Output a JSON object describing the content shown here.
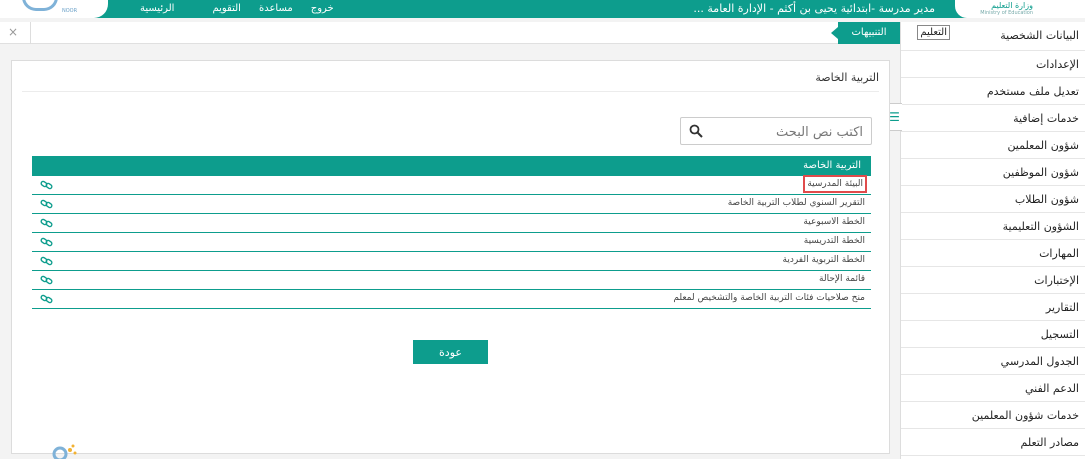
{
  "header": {
    "ministry_ar": "وزارة التعليم",
    "ministry_en": "Ministry of Education",
    "logo_sub": "NOOR",
    "title": "مدير مدرسة -ابتدائية يحيى بن أكثم - الإدارة العامة ...",
    "nav": [
      {
        "label": "الرئيسية"
      },
      {
        "label": "التقويم"
      },
      {
        "label": "مساعدة"
      },
      {
        "label": "خروج"
      }
    ]
  },
  "notifications": {
    "tab_label": "التنبيهات",
    "close_label": "×"
  },
  "sidebar": {
    "tooltip": "التعليم",
    "items": [
      {
        "label": "البيانات الشخصية"
      },
      {
        "label": "الإعدادات"
      },
      {
        "label": "تعديل ملف مستخدم"
      },
      {
        "label": "خدمات إضافية"
      },
      {
        "label": "شؤون المعلمين"
      },
      {
        "label": "شؤون الموظفين"
      },
      {
        "label": "شؤون الطلاب"
      },
      {
        "label": "الشؤون التعليمية"
      },
      {
        "label": "المهارات"
      },
      {
        "label": "الإختبارات"
      },
      {
        "label": "التقارير"
      },
      {
        "label": "التسجيل"
      },
      {
        "label": "الجدول المدرسي"
      },
      {
        "label": "الدعم الفني"
      },
      {
        "label": "خدمات شؤون المعلمين"
      },
      {
        "label": "مصادر التعلم"
      }
    ],
    "toggle_label": "☰"
  },
  "main": {
    "title": "التربية الخاصة",
    "search": {
      "placeholder": "اكتب نص البحث",
      "value": ""
    },
    "table": {
      "header": "التربية الخاصة",
      "rows": [
        {
          "label": "البيئة المدرسية",
          "highlighted": true
        },
        {
          "label": "التقرير السنوي لطلاب التربية الخاصة"
        },
        {
          "label": "الخطة الاسبوعية"
        },
        {
          "label": "الخطة التدريسية"
        },
        {
          "label": "الخطة التربوية الفردية"
        },
        {
          "label": "قائمة الإحالة"
        },
        {
          "label": "منح صلاحيات فئات التربية الخاصة والتشخيص لمعلم"
        }
      ]
    },
    "back_label": "عودة"
  },
  "colors": {
    "accent": "#0d9d8d",
    "highlight": "#e04b4b"
  }
}
